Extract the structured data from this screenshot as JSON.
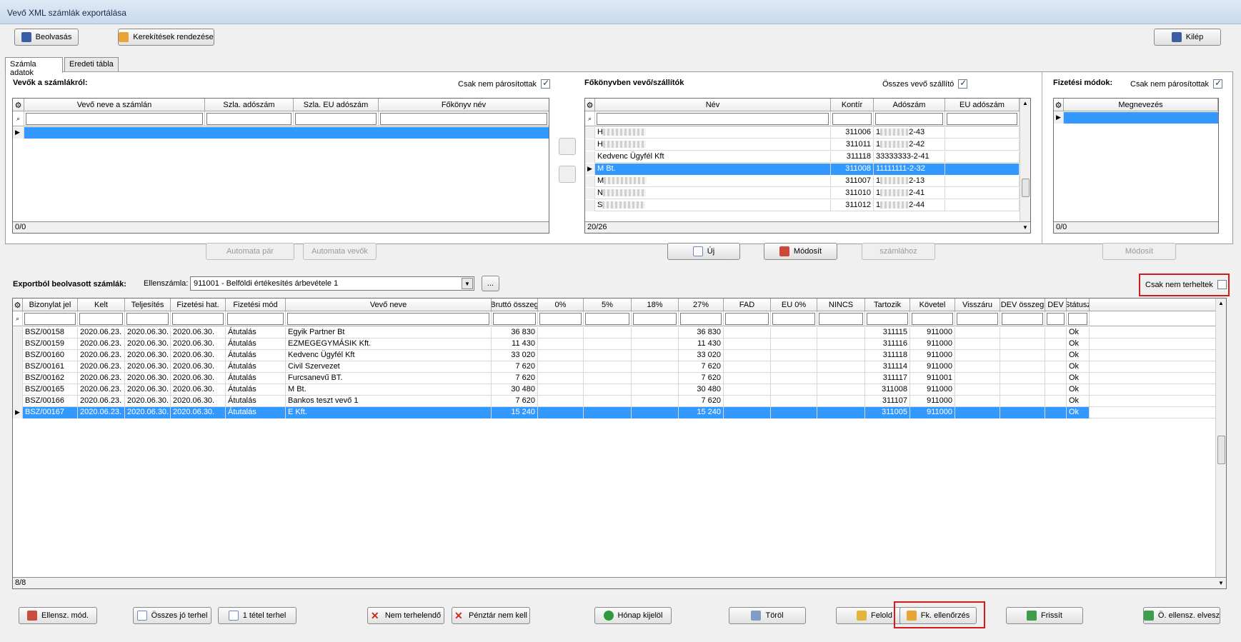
{
  "window": {
    "title": "Vevő XML számlák exportálása"
  },
  "toolbar": {
    "beolvasas": "Beolvasás",
    "kerekitesek": "Kerekítések rendezése",
    "kilep": "Kilép"
  },
  "tabs": [
    "Számla adatok",
    "Eredeti tábla"
  ],
  "left": {
    "title": "Vevők a számlákról:",
    "checkbox": "Csak nem párosítottak",
    "columns": [
      "Vevő neve a számlán",
      "Szla. adószám",
      "Szla. EU adószám",
      "Főkönyv név"
    ],
    "status": "0/0",
    "btn_auto_par": "Automata pár",
    "btn_auto_vevok": "Automata vevők"
  },
  "middle": {
    "title": "Főkönyvben vevő/szállítók",
    "checkbox": "Összes vevő szállító",
    "columns": [
      "Név",
      "Kontír",
      "Adószám",
      "EU adószám"
    ],
    "rows": [
      {
        "nev": "H",
        "kontir": "311006",
        "adoszam": "1",
        "adoszam_end": "2-43"
      },
      {
        "nev": "H",
        "kontir": "311011",
        "adoszam": "1",
        "adoszam_end": "2-42"
      },
      {
        "nev": "Kedvenc Ügyfél Kft",
        "kontir": "311118",
        "adoszam": "33333333-2-41",
        "adoszam_end": ""
      },
      {
        "nev": "M Bt.",
        "kontir": "311008",
        "adoszam": "11111111-2-32",
        "adoszam_end": ""
      },
      {
        "nev": "M",
        "kontir": "311007",
        "adoszam": "1",
        "adoszam_end": "2-13"
      },
      {
        "nev": "N",
        "kontir": "311010",
        "adoszam": "1",
        "adoszam_end": "2-41"
      },
      {
        "nev": "S",
        "kontir": "311012",
        "adoszam": "1",
        "adoszam_end": "2-44"
      }
    ],
    "selected_index": 3,
    "status": "20/26",
    "btn_uj": "Új",
    "btn_modosit": "Módosít",
    "btn_szamlahoz": "számlához"
  },
  "right": {
    "title": "Fizetési módok:",
    "checkbox": "Csak nem párosítottak",
    "columns": [
      "Megnevezés"
    ],
    "status": "0/0",
    "btn_modosit": "Módosít"
  },
  "export": {
    "title": "Exportból beolvasott számlák:",
    "ellenszamla_label": "Ellenszámla:",
    "ellenszamla_value": "911001 - Belföldi értékesítés árbevétele 1",
    "browse": "...",
    "csak_nem_terheltek": "Csak nem terheltek",
    "columns": [
      "Bizonylat jel",
      "Kelt",
      "Teljesítés",
      "Fizetési hat.",
      "Fizetési mód",
      "Vevő neve",
      "Bruttó összeg",
      "0%",
      "5%",
      "18%",
      "27%",
      "FAD",
      "EU 0%",
      "NINCS",
      "Tartozik",
      "Követel",
      "Visszáru",
      "DEV összeg",
      "DEV",
      "Státusz"
    ],
    "rows": [
      {
        "biz": "BSZ/00158",
        "kelt": "2020.06.23.",
        "telj": "2020.06.30.",
        "fhat": "2020.06.30.",
        "fmod": "Átutalás",
        "vevo": "Egyik Partner Bt",
        "brutto": "36 830",
        "p27": "36 830",
        "tart": "311115",
        "kov": "911000",
        "stat": "Ok"
      },
      {
        "biz": "BSZ/00159",
        "kelt": "2020.06.23.",
        "telj": "2020.06.30.",
        "fhat": "2020.06.30.",
        "fmod": "Átutalás",
        "vevo": "EZMEGEGYMÁSIK Kft.",
        "brutto": "11 430",
        "p27": "11 430",
        "tart": "311116",
        "kov": "911000",
        "stat": "Ok"
      },
      {
        "biz": "BSZ/00160",
        "kelt": "2020.06.23.",
        "telj": "2020.06.30.",
        "fhat": "2020.06.30.",
        "fmod": "Átutalás",
        "vevo": "Kedvenc Ügyfél Kft",
        "brutto": "33 020",
        "p27": "33 020",
        "tart": "311118",
        "kov": "911000",
        "stat": "Ok"
      },
      {
        "biz": "BSZ/00161",
        "kelt": "2020.06.23.",
        "telj": "2020.06.30.",
        "fhat": "2020.06.30.",
        "fmod": "Átutalás",
        "vevo": "Civil Szervezet",
        "brutto": "7 620",
        "p27": "7 620",
        "tart": "311114",
        "kov": "911000",
        "stat": "Ok"
      },
      {
        "biz": "BSZ/00162",
        "kelt": "2020.06.23.",
        "telj": "2020.06.30.",
        "fhat": "2020.06.30.",
        "fmod": "Átutalás",
        "vevo": "Furcsanevű BT.",
        "brutto": "7 620",
        "p27": "7 620",
        "tart": "311117",
        "kov": "911001",
        "stat": "Ok"
      },
      {
        "biz": "BSZ/00165",
        "kelt": "2020.06.23.",
        "telj": "2020.06.30.",
        "fhat": "2020.06.30.",
        "fmod": "Átutalás",
        "vevo": "M Bt.",
        "brutto": "30 480",
        "p27": "30 480",
        "tart": "311008",
        "kov": "911000",
        "stat": "Ok"
      },
      {
        "biz": "BSZ/00166",
        "kelt": "2020.06.23.",
        "telj": "2020.06.30.",
        "fhat": "2020.06.30.",
        "fmod": "Átutalás",
        "vevo": "Bankos teszt vevő 1",
        "brutto": "7 620",
        "p27": "7 620",
        "tart": "311107",
        "kov": "911000",
        "stat": "Ok"
      },
      {
        "biz": "BSZ/00167",
        "kelt": "2020.06.23.",
        "telj": "2020.06.30.",
        "fhat": "2020.06.30.",
        "fmod": "Átutalás",
        "vevo": "E Kft.",
        "brutto": "15 240",
        "p27": "15 240",
        "tart": "311005",
        "kov": "911000",
        "stat": "Ok"
      }
    ],
    "selected_index": 7,
    "status": "8/8"
  },
  "bottom": {
    "ellensz_mod": "Ellensz. mód.",
    "osszes_jo": "Összes jó terhel",
    "egy_tetel": "1 tétel terhel",
    "nem_terhelendo": "Nem terhelendő",
    "penztar": "Pénztár nem kell",
    "honap": "Hónap kijelöl",
    "torol": "Töröl",
    "felold": "Felold",
    "fk_ell": "Fk. ellenőrzés",
    "frissit": "Frissít",
    "o_ellensz": "Ö. ellensz. elvesz"
  }
}
